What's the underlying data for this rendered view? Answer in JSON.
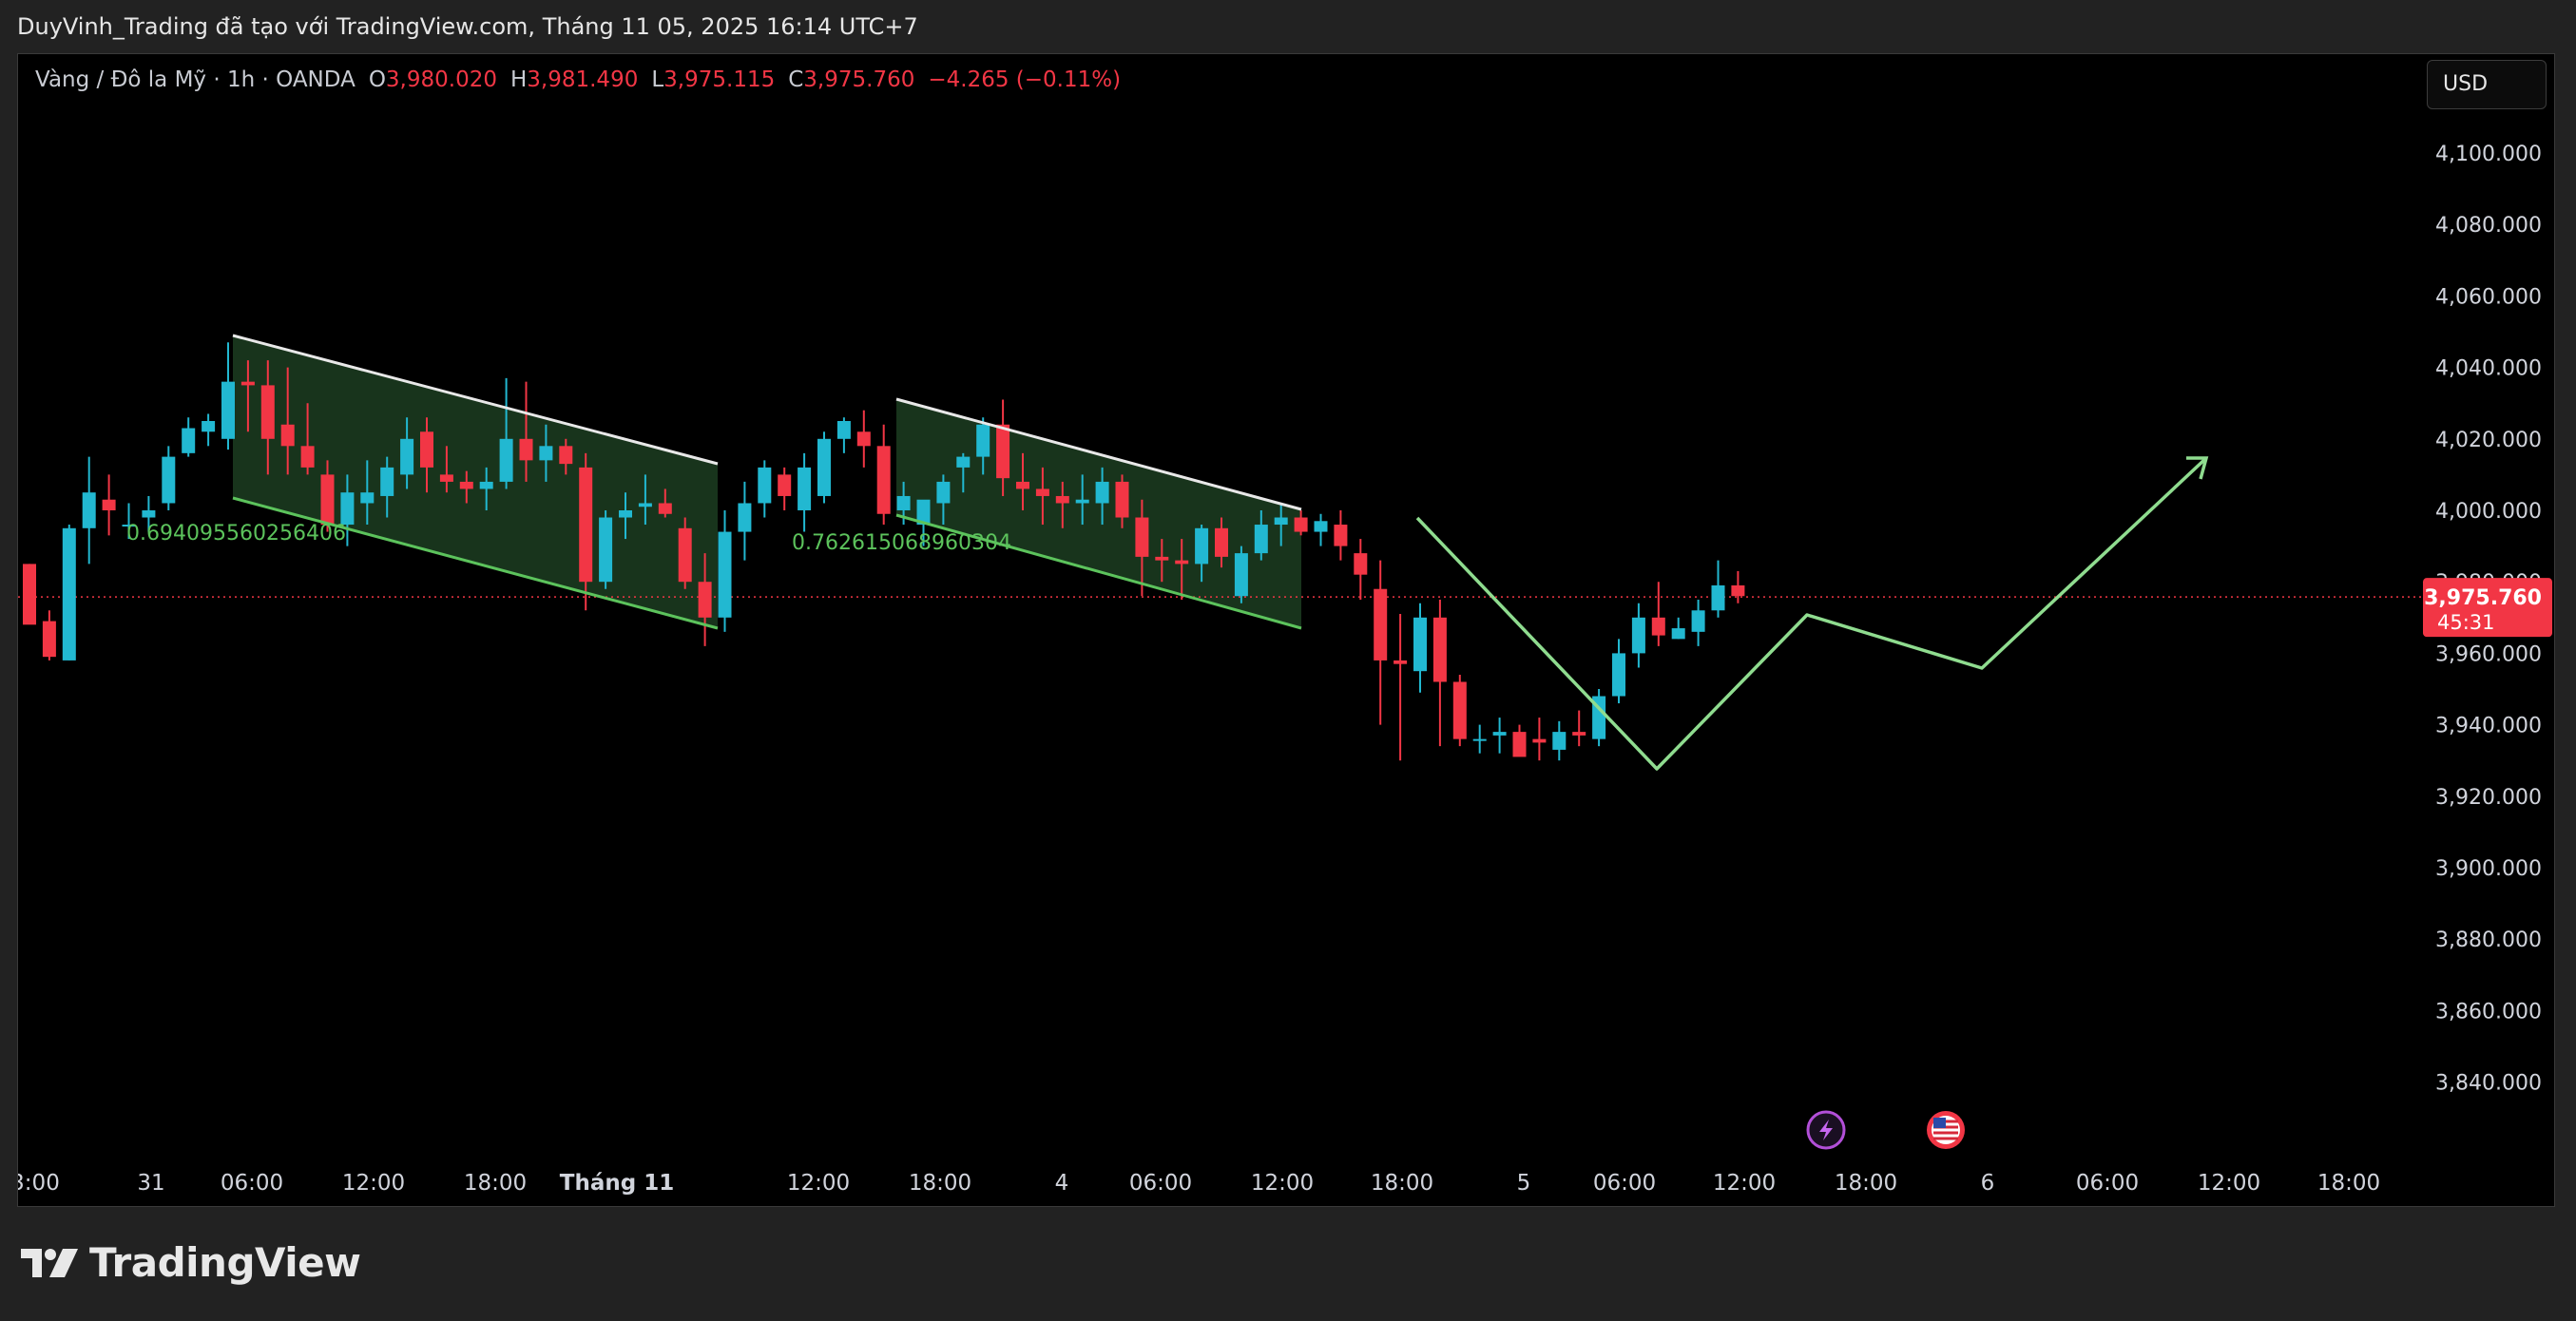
{
  "header": {
    "attribution": "DuyVinh_Trading đã tạo với TradingView.com, Tháng 11 05, 2025 16:14 UTC+7"
  },
  "legend": {
    "symbol": "Vàng / Đô la Mỹ · 1h · OANDA",
    "open_label": "O",
    "open": "3,980.020",
    "high_label": "H",
    "high": "3,981.490",
    "low_label": "L",
    "low": "3,975.115",
    "close_label": "C",
    "close": "3,975.760",
    "change": "−4.265 (−0.11%)"
  },
  "currency_button": "USD",
  "price_badge": {
    "price": "3,975.760",
    "countdown": "45:31"
  },
  "price_axis_labels": [
    "4,100.000",
    "4,080.000",
    "4,060.000",
    "4,040.000",
    "4,020.000",
    "4,000.000",
    "3,980.000",
    "3,960.000",
    "3,940.000",
    "3,920.000",
    "3,900.000",
    "3,880.000",
    "3,860.000",
    "3,840.000"
  ],
  "time_axis_labels": [
    "3:00",
    "31",
    "06:00",
    "12:00",
    "18:00",
    "Tháng 11",
    "12:00",
    "18:00",
    "4",
    "06:00",
    "12:00",
    "18:00",
    "5",
    "06:00",
    "12:00",
    "18:00",
    "6",
    "06:00",
    "12:00",
    "18:00"
  ],
  "channel_labels": [
    "0.694095560256406",
    "0.762615068960304"
  ],
  "colors": {
    "up": "#22b8d1",
    "down": "#f23645",
    "channel_fill": "#1b3a1f",
    "channel_line": "#5cc35c",
    "upper_line": "#e8e8e8",
    "projection": "#8fdc8f",
    "price_line": "#f23645"
  },
  "icons": [
    "lightning-icon",
    "us-flag-icon",
    "tradingview-logo-icon"
  ],
  "brand": "TradingView",
  "chart_data": {
    "type": "candlestick",
    "symbol": "XAU/USD",
    "interval": "1h",
    "ylim": [
      3830,
      4110
    ],
    "last_price": 3975.76,
    "candles": [
      [
        3985,
        3985,
        3970,
        3968
      ],
      [
        3969,
        3972,
        3958,
        3959
      ],
      [
        3958,
        3996,
        3958,
        3995
      ],
      [
        3995,
        4015,
        3985,
        4005
      ],
      [
        4003,
        4010,
        3993,
        4000
      ],
      [
        3996,
        4002,
        3992,
        3996
      ],
      [
        3998,
        4004,
        3994,
        4000
      ],
      [
        4002,
        4018,
        4000,
        4015
      ],
      [
        4016,
        4026,
        4015,
        4023
      ],
      [
        4022,
        4027,
        4018,
        4025
      ],
      [
        4020,
        4047,
        4017,
        4036
      ],
      [
        4036,
        4042,
        4022,
        4035
      ],
      [
        4035,
        4042,
        4010,
        4020
      ],
      [
        4024,
        4040,
        4010,
        4018
      ],
      [
        4018,
        4030,
        4010,
        4012
      ],
      [
        4010,
        4014,
        3994,
        3996
      ],
      [
        3996,
        4010,
        3990,
        4005
      ],
      [
        4002,
        4014,
        3996,
        4005
      ],
      [
        4004,
        4015,
        3998,
        4012
      ],
      [
        4010,
        4026,
        4006,
        4020
      ],
      [
        4022,
        4026,
        4005,
        4012
      ],
      [
        4010,
        4018,
        4005,
        4008
      ],
      [
        4008,
        4011,
        4002,
        4006
      ],
      [
        4006,
        4012,
        4000,
        4008
      ],
      [
        4008,
        4037,
        4006,
        4020
      ],
      [
        4020,
        4036,
        4008,
        4014
      ],
      [
        4014,
        4024,
        4008,
        4018
      ],
      [
        4018,
        4020,
        4010,
        4013
      ],
      [
        4012,
        4016,
        3972,
        3980
      ],
      [
        3980,
        4000,
        3978,
        3998
      ],
      [
        3998,
        4005,
        3992,
        4000
      ],
      [
        4001,
        4010,
        3996,
        4002
      ],
      [
        4002,
        4006,
        3998,
        3999
      ],
      [
        3995,
        3998,
        3978,
        3980
      ],
      [
        3980,
        3988,
        3962,
        3970
      ],
      [
        3970,
        4000,
        3966,
        3994
      ],
      [
        3994,
        4008,
        3986,
        4002
      ],
      [
        4002,
        4014,
        3998,
        4012
      ],
      [
        4010,
        4012,
        4000,
        4004
      ],
      [
        4000,
        4016,
        3994,
        4012
      ],
      [
        4004,
        4022,
        4002,
        4020
      ],
      [
        4020,
        4026,
        4016,
        4025
      ],
      [
        4022,
        4028,
        4012,
        4018
      ],
      [
        4018,
        4024,
        3996,
        3999
      ],
      [
        4000,
        4008,
        3996,
        4004
      ],
      [
        3996,
        4002,
        3990,
        4003
      ],
      [
        4002,
        4010,
        3996,
        4008
      ],
      [
        4012,
        4016,
        4005,
        4015
      ],
      [
        4015,
        4026,
        4010,
        4024
      ],
      [
        4024,
        4031,
        4004,
        4009
      ],
      [
        4008,
        4016,
        4000,
        4006
      ],
      [
        4006,
        4012,
        3996,
        4004
      ],
      [
        4004,
        4008,
        3995,
        4002
      ],
      [
        4002,
        4010,
        3996,
        4003
      ],
      [
        4002,
        4012,
        3996,
        4008
      ],
      [
        4008,
        4010,
        3995,
        3998
      ],
      [
        3998,
        4003,
        3976,
        3987
      ],
      [
        3987,
        3992,
        3980,
        3986
      ],
      [
        3986,
        3992,
        3975,
        3985
      ],
      [
        3985,
        3996,
        3980,
        3995
      ],
      [
        3995,
        3998,
        3984,
        3987
      ],
      [
        3976,
        3990,
        3974,
        3988
      ],
      [
        3988,
        4000,
        3986,
        3996
      ],
      [
        3996,
        4002,
        3990,
        3998
      ],
      [
        3998,
        4000,
        3993,
        3994
      ],
      [
        3994,
        3999,
        3990,
        3997
      ],
      [
        3996,
        4000,
        3986,
        3990
      ],
      [
        3988,
        3992,
        3975,
        3982
      ],
      [
        3978,
        3986,
        3940,
        3958
      ],
      [
        3958,
        3971,
        3930,
        3957
      ],
      [
        3955,
        3974,
        3949,
        3970
      ],
      [
        3970,
        3975,
        3934,
        3952
      ],
      [
        3952,
        3954,
        3934,
        3936
      ],
      [
        3936,
        3940,
        3932,
        3936
      ],
      [
        3937,
        3942,
        3932,
        3938
      ],
      [
        3938,
        3940,
        3932,
        3931
      ],
      [
        3936,
        3942,
        3930,
        3935
      ],
      [
        3933,
        3941,
        3930,
        3938
      ],
      [
        3938,
        3944,
        3934,
        3937
      ],
      [
        3936,
        3950,
        3934,
        3948
      ],
      [
        3948,
        3964,
        3946,
        3960
      ],
      [
        3960,
        3974,
        3956,
        3970
      ],
      [
        3970,
        3980,
        3962,
        3965
      ],
      [
        3964,
        3970,
        3964,
        3967
      ],
      [
        3966,
        3975,
        3962,
        3972
      ],
      [
        3972,
        3986,
        3970,
        3979
      ],
      [
        3979,
        3983,
        3974,
        3976
      ]
    ],
    "annotations": [
      {
        "type": "channel",
        "value_label": "0.694095560256406"
      },
      {
        "type": "channel",
        "value_label": "0.762615068960304"
      },
      {
        "type": "projection_path"
      }
    ]
  }
}
